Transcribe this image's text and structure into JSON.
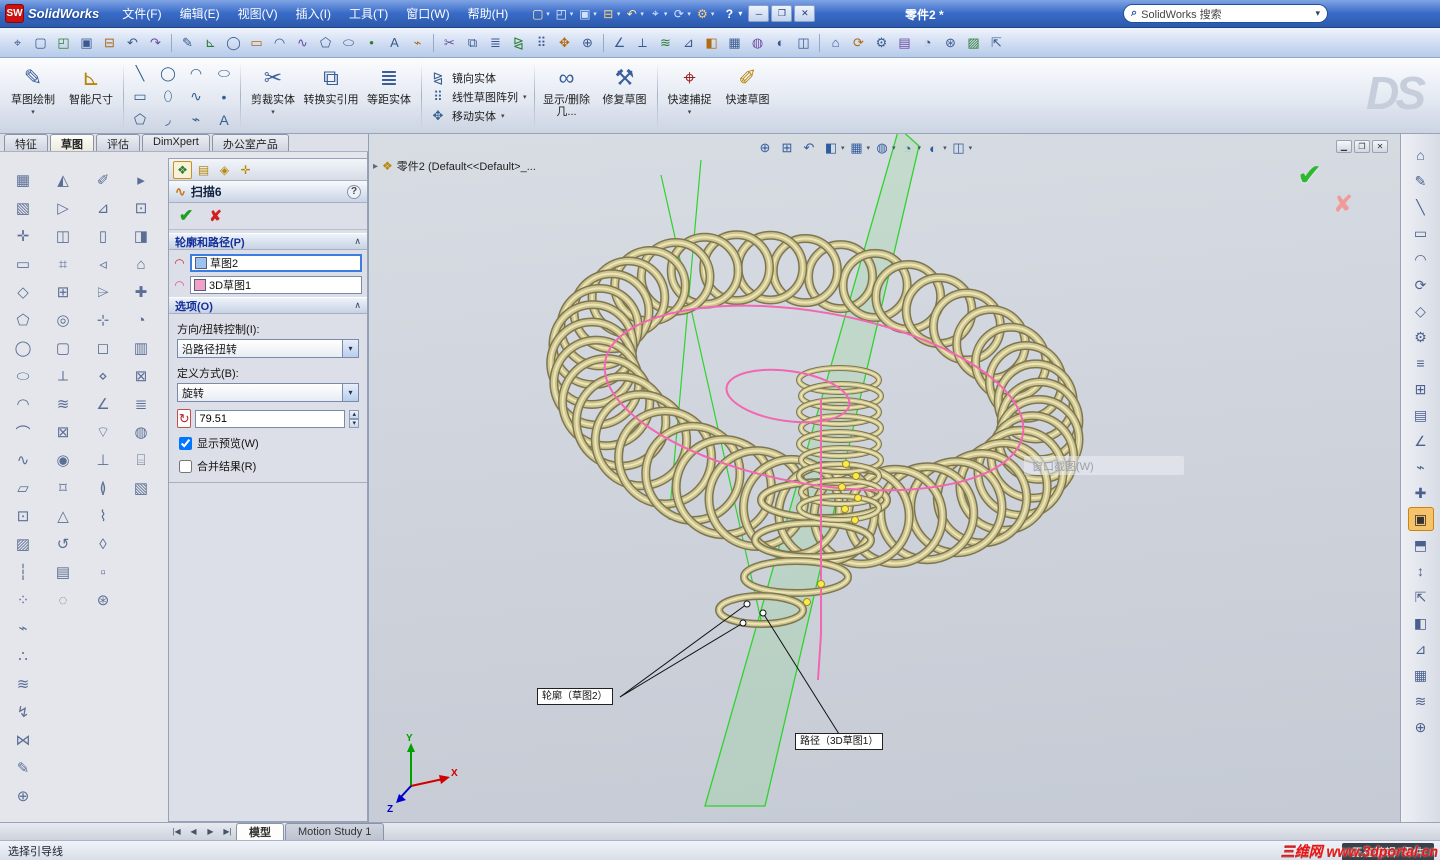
{
  "ui": {
    "dd": "▾",
    "up": "▴"
  },
  "titlebar": {
    "logo_text": "SolidWorks",
    "menus": [
      "文件(F)",
      "编辑(E)",
      "视图(V)",
      "插入(I)",
      "工具(T)",
      "窗口(W)",
      "帮助(H)"
    ],
    "tools": [
      {
        "name": "new-document-icon",
        "glyph": "▢"
      },
      {
        "name": "open-icon",
        "glyph": "◰"
      },
      {
        "name": "save-icon",
        "glyph": "▣"
      },
      {
        "name": "print-icon",
        "glyph": "⊟"
      },
      {
        "name": "undo-icon",
        "glyph": "↶"
      },
      {
        "name": "select-icon",
        "glyph": "⌖"
      },
      {
        "name": "rebuild-icon",
        "glyph": "⟳"
      },
      {
        "name": "options-icon",
        "glyph": "⚙"
      }
    ],
    "doc_title": "零件2 *",
    "search_icon": "⌕",
    "search_placeholder": "SolidWorks 搜索",
    "help": "?",
    "win": {
      "min": "─",
      "restore": "❐",
      "close": "✕"
    }
  },
  "main_toolbar": {
    "icons": [
      "⌖",
      "▢",
      "◰",
      "▣",
      "⊟",
      "↶",
      "↷",
      "|",
      "✎",
      "⊾",
      "◯",
      "▭",
      "◠",
      "∿",
      "⬠",
      "⬭",
      "•",
      "A",
      "⌁",
      "|",
      "✂",
      "⧉",
      "≣",
      "⧎",
      "⠿",
      "✥",
      "⊕",
      "|",
      "∠",
      "⟂",
      "≋",
      "⊿",
      "◧",
      "▦",
      "◍",
      "◐",
      "◫",
      "|",
      "⌂",
      "⟳",
      "⚙",
      "▤",
      "◔",
      "⊛",
      "▨",
      "⇱"
    ]
  },
  "tabs": {
    "items": [
      "特征",
      "草图",
      "评估",
      "DimXpert",
      "办公室产品"
    ],
    "active_index": 1
  },
  "ribbon": {
    "watermark": "DS",
    "sketch": {
      "label": "草图绘制",
      "icon": "✎"
    },
    "smart_dimension": {
      "label": "智能尺寸",
      "icon": "⊾"
    },
    "sketch_tools": [
      {
        "name": "line-icon",
        "glyph": "╲"
      },
      {
        "name": "circle-icon",
        "glyph": "◯"
      },
      {
        "name": "arc-icon",
        "glyph": "◠"
      },
      {
        "name": "ellipse-icon",
        "glyph": "⬭"
      },
      {
        "name": "rectangle-icon",
        "glyph": "▭"
      },
      {
        "name": "slot-icon",
        "glyph": "⬯"
      },
      {
        "name": "spline-icon",
        "glyph": "∿"
      },
      {
        "name": "point-icon",
        "glyph": "•"
      },
      {
        "name": "polygon-icon",
        "glyph": "⬠"
      },
      {
        "name": "fillet-icon",
        "glyph": "◞"
      },
      {
        "name": "centerline-icon",
        "glyph": "⌁"
      },
      {
        "name": "text-icon",
        "glyph": "A"
      }
    ],
    "trim": {
      "label": "剪裁实体",
      "icon": "✂"
    },
    "convert": {
      "label": "转换实引用",
      "icon": "⧉"
    },
    "offset": {
      "label": "等距实体",
      "icon": "≣"
    },
    "mirror": {
      "label": "镜向实体",
      "icon": "⧎"
    },
    "pattern": {
      "label": "线性草图阵列",
      "icon": "⠿"
    },
    "move": {
      "label": "移动实体",
      "icon": "✥"
    },
    "display_relations": {
      "label": "显示/删除几...",
      "icon": "∞"
    },
    "repair": {
      "label": "修复草图",
      "icon": "⚒"
    },
    "quick_snap": {
      "label": "快速捕捉",
      "icon": "⌖"
    },
    "quick_sketch": {
      "label": "快速草图",
      "icon": "✐"
    }
  },
  "pm": {
    "tab_icons": [
      {
        "name": "pm-properties-tab-icon",
        "glyph": "❖"
      },
      {
        "name": "pm-configurations-tab-icon",
        "glyph": "▤"
      },
      {
        "name": "pm-dimxpert-tab-icon",
        "glyph": "◈"
      },
      {
        "name": "pm-display-pane-tab-icon",
        "glyph": "✛"
      }
    ],
    "title_icon": "∿",
    "title": "扫描6",
    "help": "?",
    "ok_glyph": "✔",
    "cancel_glyph": "✘",
    "chevron": "∧",
    "profile_path": {
      "label": "轮廓和路径(P)",
      "profile_icon": "◠",
      "profile_value": "草图2",
      "path_icon": "◠",
      "path_value": "3D草图1"
    },
    "options": {
      "label": "选项(O)",
      "orientation_label": "方向/扭转控制(I):",
      "orientation_value": "沿路径扭转",
      "define_label": "定义方式(B):",
      "define_value": "旋转",
      "angle_icon": "↻",
      "angle_value": "79.51",
      "show_preview_label": "显示预览(W)",
      "show_preview_checked": true,
      "merge_result_label": "合并结果(R)",
      "merge_result_checked": false
    }
  },
  "left_toolbars": [
    [
      "▦",
      "▧",
      "✛",
      "▭",
      "◇",
      "⬠",
      "◯",
      "⬭",
      "◠",
      "⌒",
      "∿",
      "▱",
      "⊡",
      "▨",
      "┆",
      "⁘",
      "⌁",
      "∴",
      "≋",
      "↯",
      "⋈",
      "✎",
      "⊕"
    ],
    [
      "◭",
      "▷",
      "◫",
      "⌗",
      "⊞",
      "◎",
      "▢",
      "⟂",
      "≋",
      "⊠",
      "◉",
      "⌑",
      "△",
      "↺",
      "▤",
      "◌"
    ],
    [
      "✐",
      "⊿",
      "▯",
      "◃",
      "⌲",
      "⊹",
      "◻",
      "⋄",
      "∠",
      "⌔",
      "⊥",
      "≬",
      "⌇",
      "◊",
      "▫",
      "⊛"
    ],
    [
      "▸",
      "⊡",
      "◨",
      "⌂",
      "✚",
      "◔",
      "▥",
      "⊠",
      "≣",
      "◍",
      "⌸",
      "▧"
    ]
  ],
  "viewport": {
    "tree_arrow": "▸",
    "tree_icon": "❖",
    "tree_label": "零件2 (Default<<Default>_...",
    "headsup": [
      {
        "name": "zoom-fit-icon",
        "glyph": "⊕",
        "dd": false
      },
      {
        "name": "zoom-area-icon",
        "glyph": "⊞",
        "dd": false
      },
      {
        "name": "previous-view-icon",
        "glyph": "↶",
        "dd": false
      },
      {
        "name": "section-view-icon",
        "glyph": "◧",
        "dd": true
      },
      {
        "name": "view-orientation-icon",
        "glyph": "▦",
        "dd": true
      },
      {
        "name": "display-style-icon",
        "glyph": "◍",
        "dd": true
      },
      {
        "name": "hide-show-icon",
        "glyph": "◔",
        "dd": true
      },
      {
        "name": "edit-appearance-icon",
        "glyph": "◐",
        "dd": true
      },
      {
        "name": "apply-scene-icon",
        "glyph": "◫",
        "dd": true
      }
    ],
    "win": {
      "min": "▁",
      "restore": "❐",
      "close": "✕"
    },
    "confirm": {
      "ok": "✔",
      "cancel": "✘"
    },
    "ghost_text": "窗口截图(W)",
    "profile_label": "轮廓（草图2）",
    "path_label": "路径（3D草图1）",
    "triad": {
      "x": "X",
      "y": "Y",
      "z": "Z"
    }
  },
  "right_toolbar": {
    "icons": [
      "⌂",
      "✎",
      "╲",
      "▭",
      "◠",
      "⟳",
      "◇",
      "⚙",
      "≡",
      "⊞",
      "▤",
      "∠",
      "⌁",
      "✚",
      "▣",
      "⬒",
      "↕",
      "⇱",
      "◧",
      "⊿",
      "▦",
      "≋",
      "⊕"
    ],
    "highlight_index": 14
  },
  "bottom": {
    "nav": [
      "|◀",
      "◀",
      "▶",
      "▶|"
    ],
    "tabs": [
      {
        "label": "模型",
        "active": true
      },
      {
        "label": "Motion Study 1",
        "active": false
      }
    ],
    "status_left": "选择引导线",
    "status_right": "正在编辑: 零件",
    "watermark": "三维网 www.3dportal.cn"
  },
  "colors": {
    "model": "#cdc48e",
    "model_dark": "#7d7650",
    "model_light": "#ece5b6",
    "path_pink": "#f266b2",
    "plane_green": "#2ed32e",
    "point_yellow": "#ffe84a",
    "accent_blue": "#316ac5"
  }
}
